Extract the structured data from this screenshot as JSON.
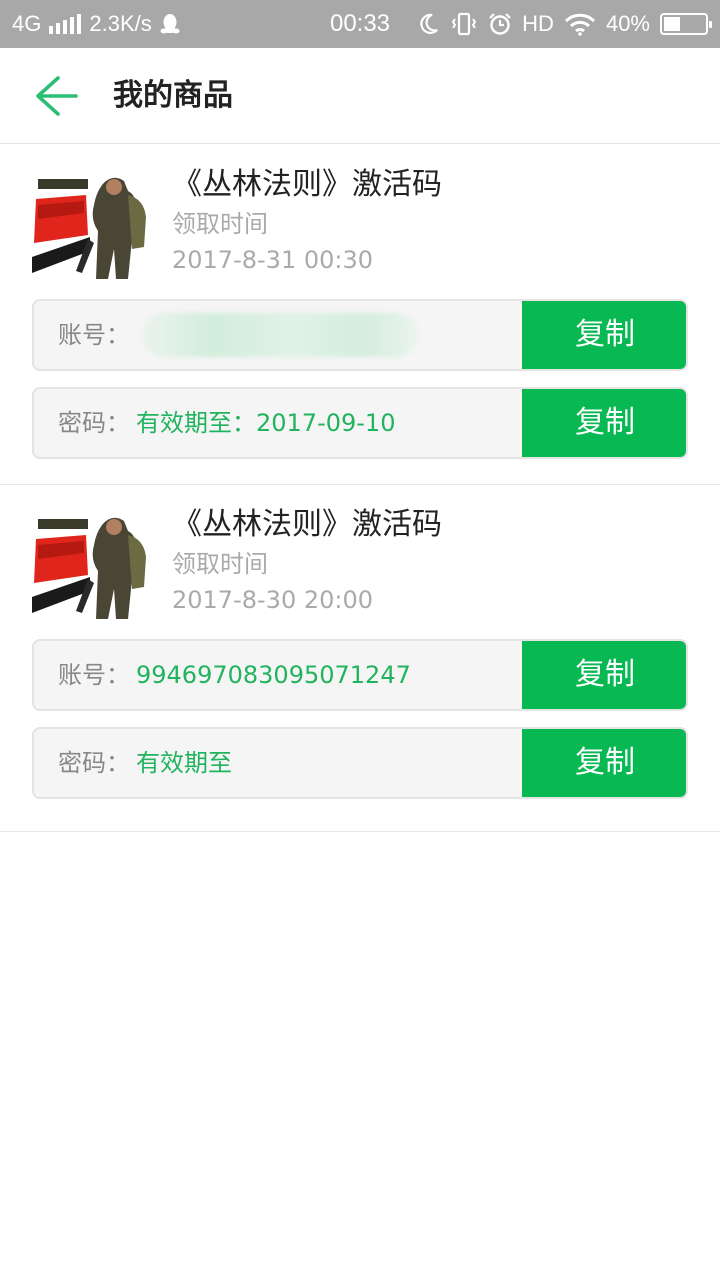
{
  "status_bar": {
    "network": "4G",
    "speed": "2.3K/s",
    "time": "00:33",
    "hd": "HD",
    "battery_percent": "40%",
    "battery_level": 0.4,
    "icons": [
      "signal-icon",
      "qq-icon",
      "moon-icon",
      "vibrate-icon",
      "alarm-icon",
      "wifi-icon",
      "battery-icon"
    ]
  },
  "header": {
    "title": "我的商品",
    "back_icon": "arrow-left-icon",
    "accent_color": "#2bbf76"
  },
  "items": [
    {
      "title": "《丛林法则》激活码",
      "time_label": "领取时间",
      "time": "2017-8-31 00:30",
      "account_label": "账号：",
      "account_value": "",
      "password_label": "密码：",
      "password_value": "有效期至：2017-09-10",
      "copy_label": "复制"
    },
    {
      "title": "《丛林法则》激活码",
      "time_label": "领取时间",
      "time": "2017-8-30 20:00",
      "account_label": "账号：",
      "account_value": "994697083095071247",
      "password_label": "密码：",
      "password_value": "有效期至",
      "copy_label": "复制"
    }
  ],
  "colors": {
    "copy_button": "#07b853",
    "value_text": "#22b35e",
    "status_bar": "#a8a8a8"
  }
}
